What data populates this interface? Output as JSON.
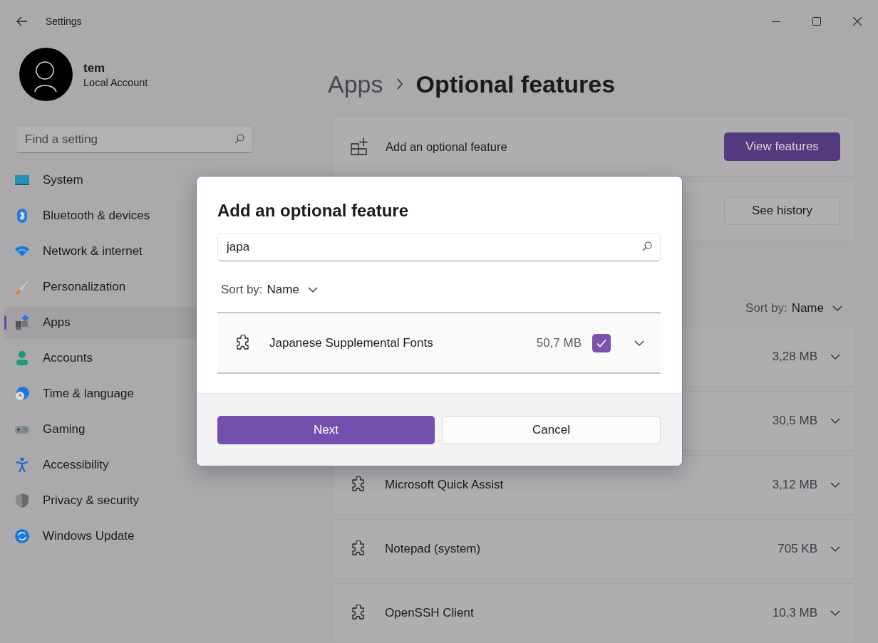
{
  "window": {
    "title": "Settings"
  },
  "profile": {
    "name": "tem",
    "account_type": "Local Account"
  },
  "search": {
    "placeholder": "Find a setting"
  },
  "nav": [
    {
      "label": "System",
      "selected": false
    },
    {
      "label": "Bluetooth & devices",
      "selected": false
    },
    {
      "label": "Network & internet",
      "selected": false
    },
    {
      "label": "Personalization",
      "selected": false
    },
    {
      "label": "Apps",
      "selected": true
    },
    {
      "label": "Accounts",
      "selected": false
    },
    {
      "label": "Time & language",
      "selected": false
    },
    {
      "label": "Gaming",
      "selected": false
    },
    {
      "label": "Accessibility",
      "selected": false
    },
    {
      "label": "Privacy & security",
      "selected": false
    },
    {
      "label": "Windows Update",
      "selected": false
    }
  ],
  "breadcrumb": {
    "parent": "Apps",
    "current": "Optional features"
  },
  "add_feature_card": {
    "label": "Add an optional feature",
    "button": "View features"
  },
  "history_card": {
    "button": "See history"
  },
  "installed": {
    "sort_label": "Sort by:",
    "sort_value": "Name",
    "features": [
      {
        "size": "3,28 MB"
      },
      {
        "size": "30,5 MB"
      },
      {
        "name": "Microsoft Quick Assist",
        "size": "3,12 MB"
      },
      {
        "name": "Notepad (system)",
        "size": "705 KB"
      },
      {
        "name": "OpenSSH Client",
        "size": "10,3 MB"
      }
    ]
  },
  "dialog": {
    "title": "Add an optional feature",
    "search_value": "japa",
    "sort_label": "Sort by:",
    "sort_value": "Name",
    "results": [
      {
        "name": "Japanese Supplemental Fonts",
        "size": "50,7 MB",
        "checked": true
      }
    ],
    "primary_button": "Next",
    "secondary_button": "Cancel"
  }
}
